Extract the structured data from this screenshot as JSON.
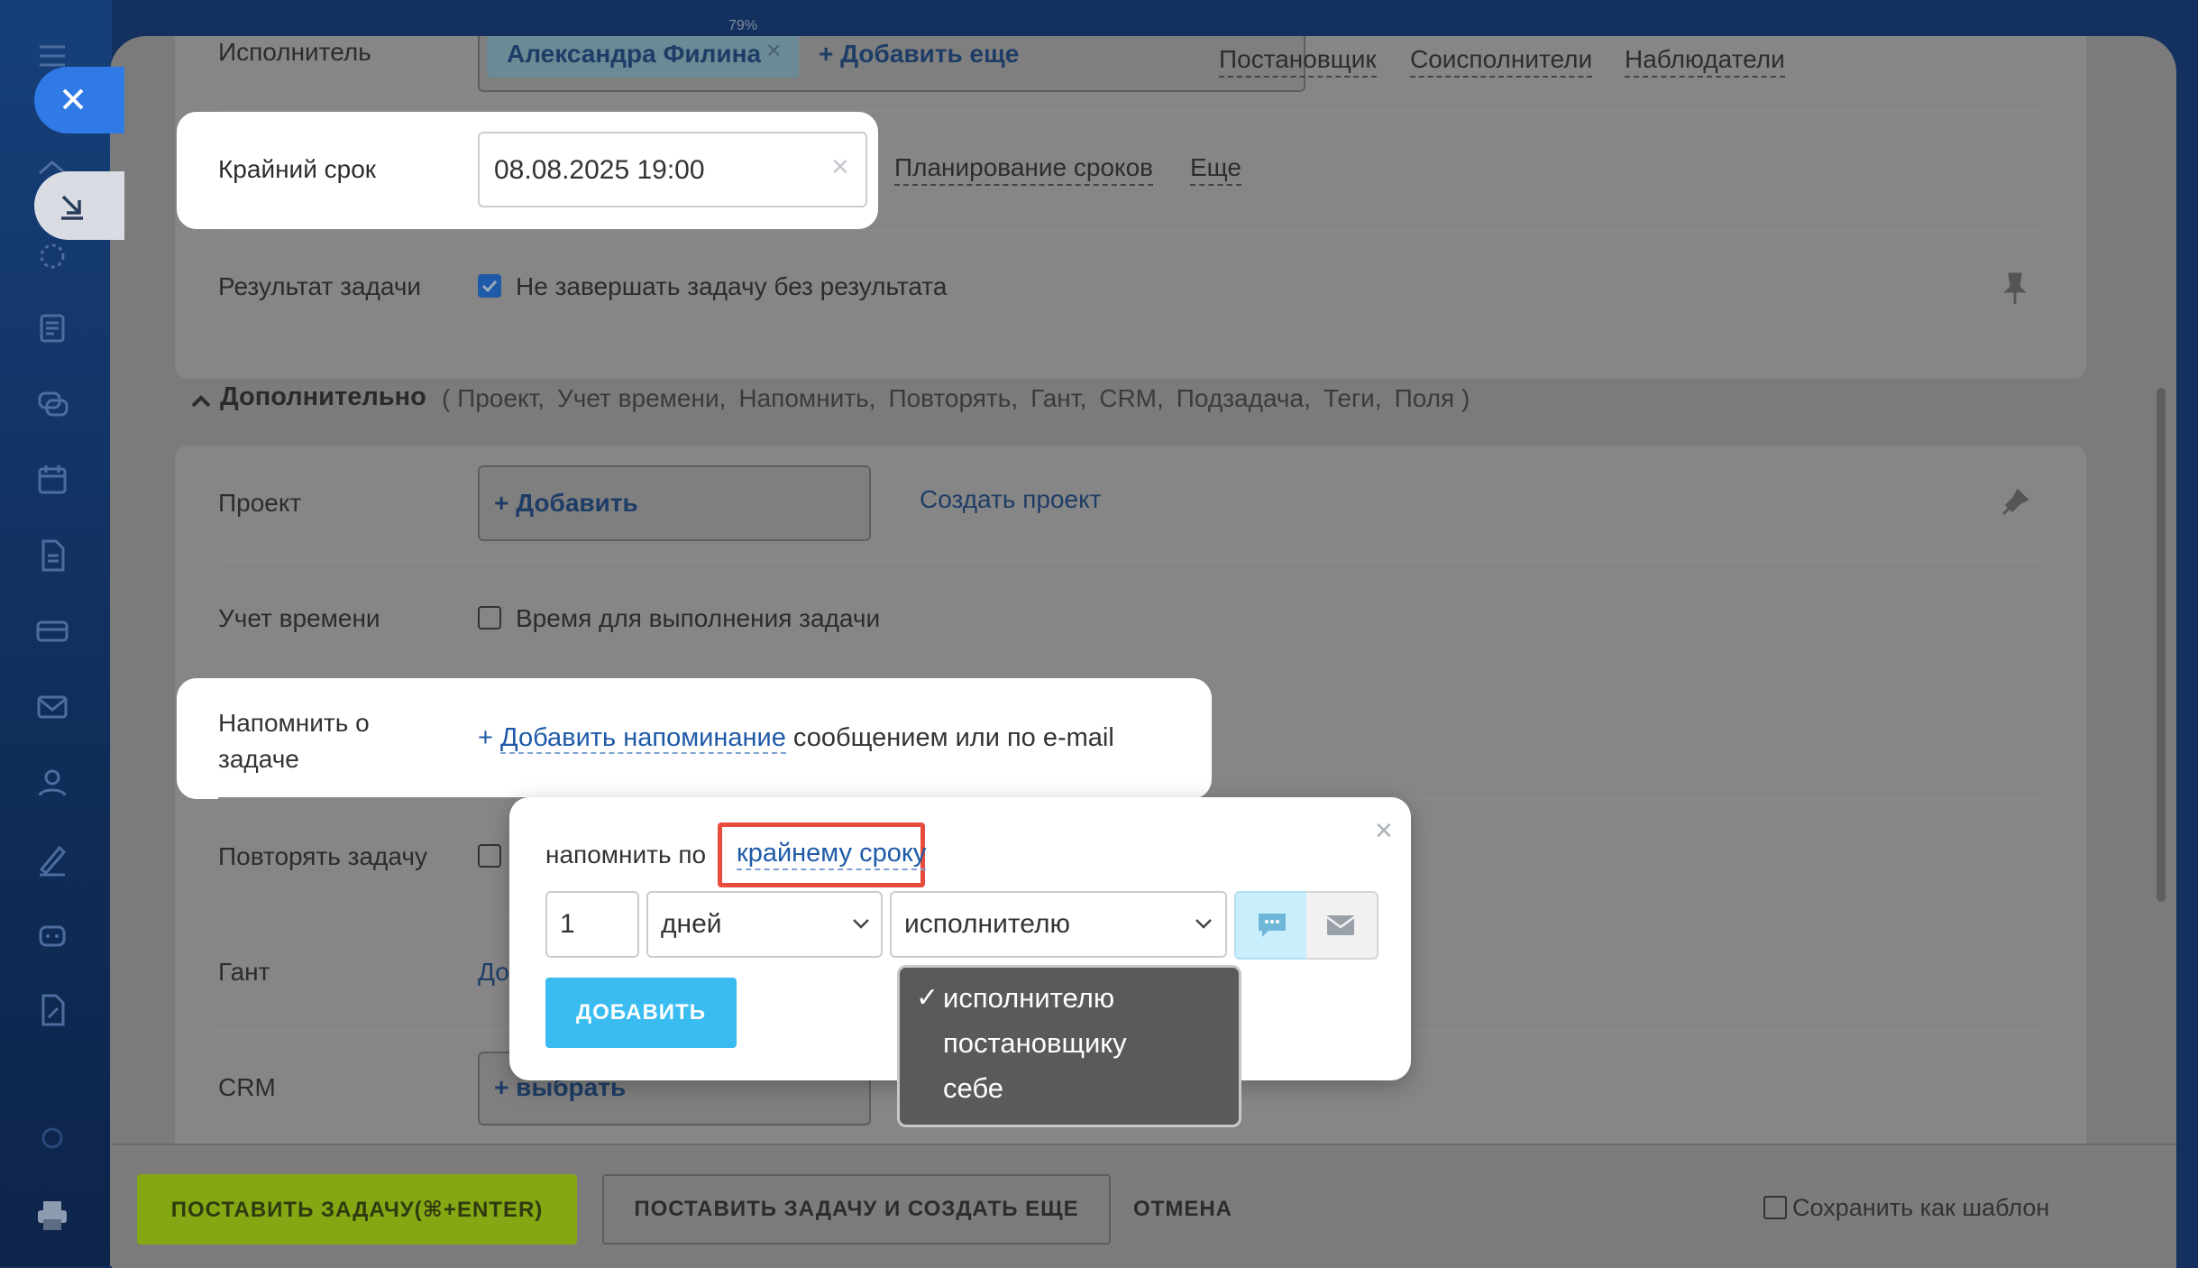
{
  "zoom": "79%",
  "colors": {
    "accent": "#2f7ae5",
    "add_button": "#3bbcf0",
    "submit_button": "#85a714",
    "highlight_border": "#e74c3c",
    "link": "#1f5aa8"
  },
  "sidebar": {
    "icons": [
      "close-icon",
      "collapse-icon",
      "home-icon",
      "tasks-icon",
      "feed-icon",
      "chat-icon",
      "calendar-icon",
      "document-icon",
      "crm-icon",
      "mail-icon",
      "contacts-icon",
      "sign-icon",
      "robot-icon",
      "forms-icon",
      "settings-icon",
      "print-icon"
    ]
  },
  "assignee": {
    "label": "Исполнитель",
    "chip": "Александра Филина",
    "add_more": "+ Добавить еще",
    "roles": [
      "Постановщик",
      "Соисполнители",
      "Наблюдатели"
    ]
  },
  "deadline": {
    "label": "Крайний срок",
    "value": "08.08.2025 19:00",
    "planning": "Планирование сроков",
    "more": "Еще"
  },
  "result": {
    "label": "Результат задачи",
    "checkbox_label": "Не завершать задачу без результата",
    "checked": true
  },
  "additional": {
    "title": "Дополнительно",
    "items": [
      "( Проект,",
      "Учет времени,",
      "Напомнить,",
      "Повторять,",
      "Гант,",
      "CRM,",
      "Подзадача,",
      "Теги,",
      "Поля )"
    ]
  },
  "project": {
    "label": "Проект",
    "add": "+ Добавить",
    "create": "Создать проект"
  },
  "time_tracking": {
    "label": "Учет времени",
    "checkbox_label": "Время для выполнения задачи"
  },
  "reminder": {
    "label_line1": "Напомнить о",
    "label_line2": "задаче",
    "add_prefix": "+ ",
    "add_link": "Добавить напоминание",
    "add_suffix": " сообщением или по e-mail"
  },
  "repeat": {
    "label": "Повторять задачу"
  },
  "gantt": {
    "label": "Гант",
    "link": "До"
  },
  "crm": {
    "label": "CRM",
    "select": "+ выбрать"
  },
  "popup": {
    "prefix": "напомнить по",
    "link": "крайнему сроку",
    "amount": "1",
    "unit": "дней",
    "recipient": "исполнителю",
    "add_button": "ДОБАВИТЬ",
    "options": [
      "исполнителю",
      "постановщику",
      "себе"
    ],
    "checkmark": "✓"
  },
  "footer": {
    "submit": "ПОСТАВИТЬ ЗАДАЧУ(⌘+ENTER)",
    "submit_more": "ПОСТАВИТЬ ЗАДАЧУ И СОЗДАТЬ ЕЩЕ",
    "cancel": "ОТМЕНА",
    "template": "Сохранить как шаблон"
  }
}
